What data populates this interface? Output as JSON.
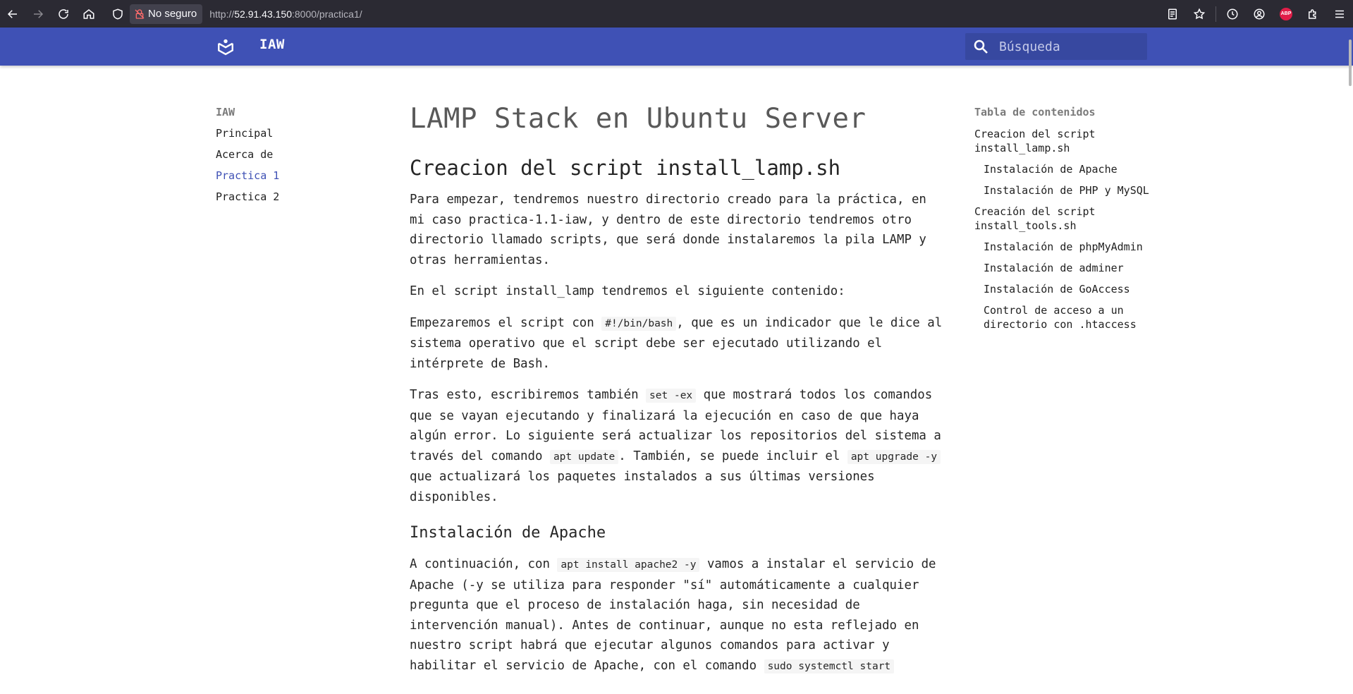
{
  "browser": {
    "security_label": "No seguro",
    "url_prefix": "http://",
    "url_host": "52.91.43.150",
    "url_path": ":8000/practica1/"
  },
  "site": {
    "title": "IAW",
    "search_placeholder": "Búsqueda",
    "header_color": "#3f51b5"
  },
  "left_nav": {
    "title": "IAW",
    "items": [
      "Principal",
      "Acerca de",
      "Practica 1",
      "Practica 2"
    ],
    "active": "Practica 1"
  },
  "toc": {
    "title": "Tabla de contenidos",
    "items": [
      "Creacion del script install_lamp.sh",
      "Instalación de Apache",
      "Instalación de PHP y MySQL",
      "Creación del script install_tools.sh",
      "Instalación de phpMyAdmin",
      "Instalación de adminer",
      "Instalación de GoAccess",
      "Control de acceso a un directorio con .htaccess"
    ]
  },
  "content": {
    "h1": "LAMP Stack en Ubuntu Server",
    "h2": "Creacion del script install_lamp.sh",
    "p1": "Para empezar, tendremos nuestro directorio creado para la práctica, en mi caso practica-1.1-iaw, y dentro de este directorio tendremos otro directorio llamado scripts, que será donde instalaremos la pila LAMP y otras herramientas.",
    "p2": "En el script install_lamp tendremos el siguiente contenido:",
    "p3_a": "Empezaremos el script con ",
    "p3_code": "#!/bin/bash",
    "p3_b": ", que es un indicador que le dice al sistema operativo que el script debe ser ejecutado utilizando el intérprete de Bash.",
    "p4_a": "Tras esto, escribiremos también ",
    "p4_code1": "set -ex",
    "p4_b": " que mostrará todos los comandos que se vayan ejecutando y finalizará la ejecución en caso de que haya algún error. Lo siguiente será actualizar los repositorios del sistema a través del comando ",
    "p4_code2": "apt update",
    "p4_c": ". También, se puede incluir el ",
    "p4_code3": "apt upgrade -y",
    "p4_d": " que actualizará los paquetes instalados a sus últimas versiones disponibles.",
    "h3": "Instalación de Apache",
    "p5_a": "A continuación, con ",
    "p5_code1": "apt install apache2 -y",
    "p5_b": " vamos a instalar el servicio de Apache (-y se utiliza para responder \"sí\" automáticamente a cualquier pregunta que el proceso de instalación haga, sin necesidad de intervención manual). Antes de continuar, aunque no esta reflejado en nuestro script habrá que ejecutar algunos comandos para activar y habilitar el servicio de Apache, con el comando ",
    "p5_code2": "sudo systemctl start"
  }
}
